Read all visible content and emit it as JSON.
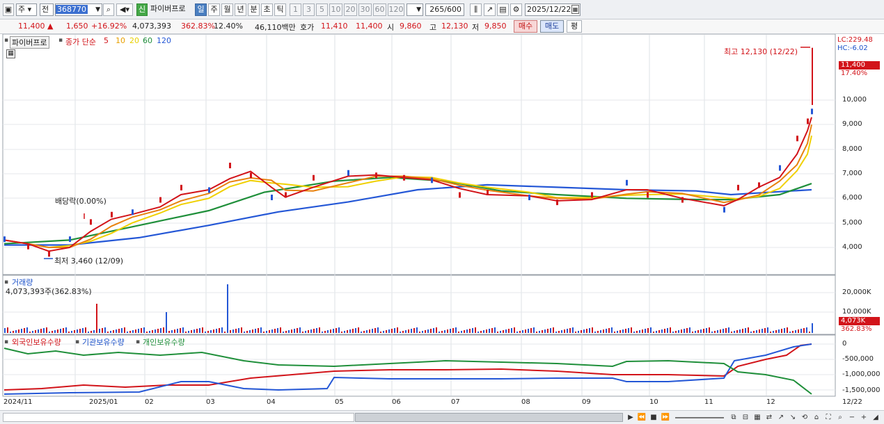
{
  "toolbar": {
    "type_sel": "주",
    "range_sel": "전",
    "code": "368770",
    "badge_new": "신",
    "name": "파이버프로",
    "periods": [
      "일",
      "주",
      "월",
      "년",
      "분",
      "초",
      "틱"
    ],
    "intervals": [
      "1",
      "3",
      "5",
      "10",
      "20",
      "30",
      "60",
      "120"
    ],
    "count_value": "265",
    "count_total": "/600",
    "date": "2025/12/22"
  },
  "quote": {
    "price": "11,400",
    "arrow": "▲",
    "change": "1,650",
    "change_pct": "+16.92%",
    "volume": "4,073,393",
    "vol_ratio": "362.83%",
    "turnover": "12.40%",
    "amount": "46,110백만",
    "hoga_label": "호가",
    "ask": "11,410",
    "bid": "11,400",
    "open_label": "시",
    "open": "9,860",
    "high_label": "고",
    "high": "12,130",
    "low_label": "저",
    "low": "9,850",
    "buy_btn": "매수",
    "sell_btn": "매도",
    "eval_btn": "평"
  },
  "price_panel": {
    "name_tag": "파이버프로",
    "ma_label": "종가 단순",
    "ma_periods": [
      "5",
      "10",
      "20",
      "60",
      "120"
    ],
    "ma_colors": [
      "#d2141a",
      "#e8820e",
      "#f0d000",
      "#1f8f3a",
      "#2457d6"
    ],
    "lc": "LC:229.48",
    "hc": "HC:-6.02",
    "high_note": "최고 12,130 (12/22)",
    "low_note": "최저 3,460 (12/09)",
    "dividend_note": "배당락(0.00%)",
    "cur_price_tag": "11,400",
    "cur_pct_tag": "17.40%",
    "y_ticks": [
      "10,000",
      "9,000",
      "8,000",
      "7,000",
      "6,000",
      "5,000",
      "4,000"
    ]
  },
  "volume_panel": {
    "title": "거래량",
    "value": "4,073,393주(362.83%)",
    "y_ticks": [
      "20,000K",
      "10,000K"
    ],
    "tag_value": "4,073K",
    "tag_pct": "362.83%"
  },
  "holding_panel": {
    "series": [
      "외국인보유수량",
      "기관보유수량",
      "개인보유수량"
    ],
    "series_colors": [
      "#d2141a",
      "#2457d6",
      "#1f8f3a"
    ],
    "y_ticks": [
      "0",
      "-500,000",
      "-1,000,000",
      "-1,500,000"
    ]
  },
  "x_axis": [
    "2024/11",
    "2025/01",
    "02",
    "03",
    "04",
    "05",
    "06",
    "07",
    "08",
    "09",
    "10",
    "11",
    "12",
    "12/22"
  ]
}
